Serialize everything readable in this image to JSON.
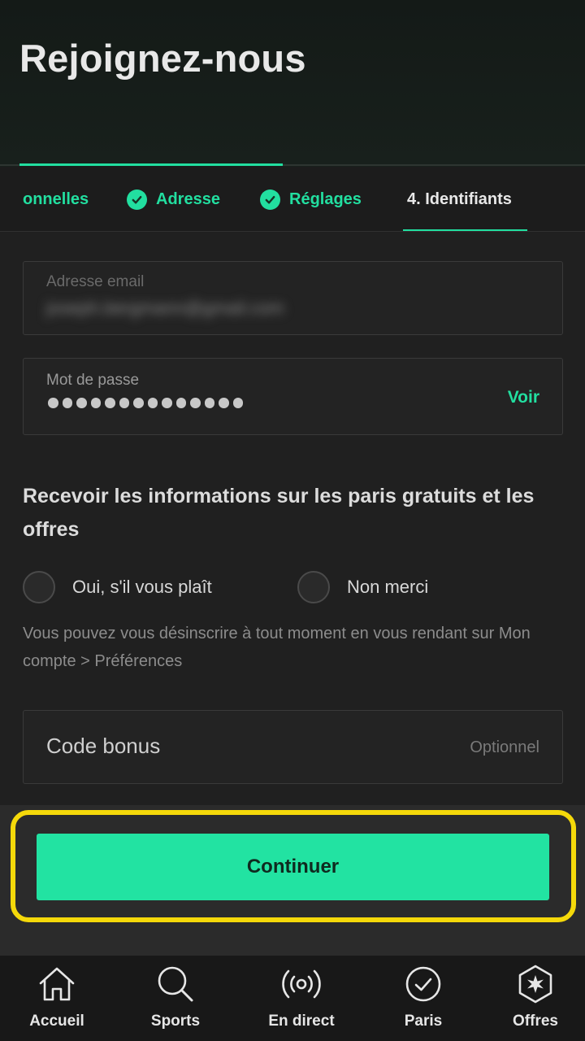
{
  "header": {
    "title": "Rejoignez-nous"
  },
  "steps": [
    {
      "label": "onnelles",
      "completed": true
    },
    {
      "label": "Adresse",
      "completed": true
    },
    {
      "label": "Réglages",
      "completed": true
    },
    {
      "label": "4. Identifiants",
      "completed": false,
      "active": true
    }
  ],
  "form": {
    "email": {
      "label": "Adresse email",
      "value": "joseph.bergmann@gmail.com",
      "obscured": true
    },
    "password": {
      "label": "Mot de passe",
      "masked_length": 14,
      "show_label": "Voir"
    },
    "newsletter": {
      "title": "Recevoir les informations sur les paris gratuits et les offres",
      "options": [
        "Oui, s'il vous plaît",
        "Non merci"
      ],
      "note": "Vous pouvez vous désinscrire à tout moment en vous rendant sur Mon compte > Préférences"
    },
    "bonus": {
      "label": "Code bonus",
      "optional_label": "Optionnel"
    }
  },
  "continue_label": "Continuer",
  "nav": [
    {
      "label": "Accueil",
      "icon": "home-icon"
    },
    {
      "label": "Sports",
      "icon": "search-icon"
    },
    {
      "label": "En direct",
      "icon": "live-broadcast-icon"
    },
    {
      "label": "Paris",
      "icon": "check-circle-icon"
    },
    {
      "label": "Offres",
      "icon": "star-badge-icon"
    }
  ],
  "colors": {
    "accent": "#22dfa0",
    "button": "#22e3a2",
    "highlight": "#f5d90a",
    "background": "#202020"
  }
}
